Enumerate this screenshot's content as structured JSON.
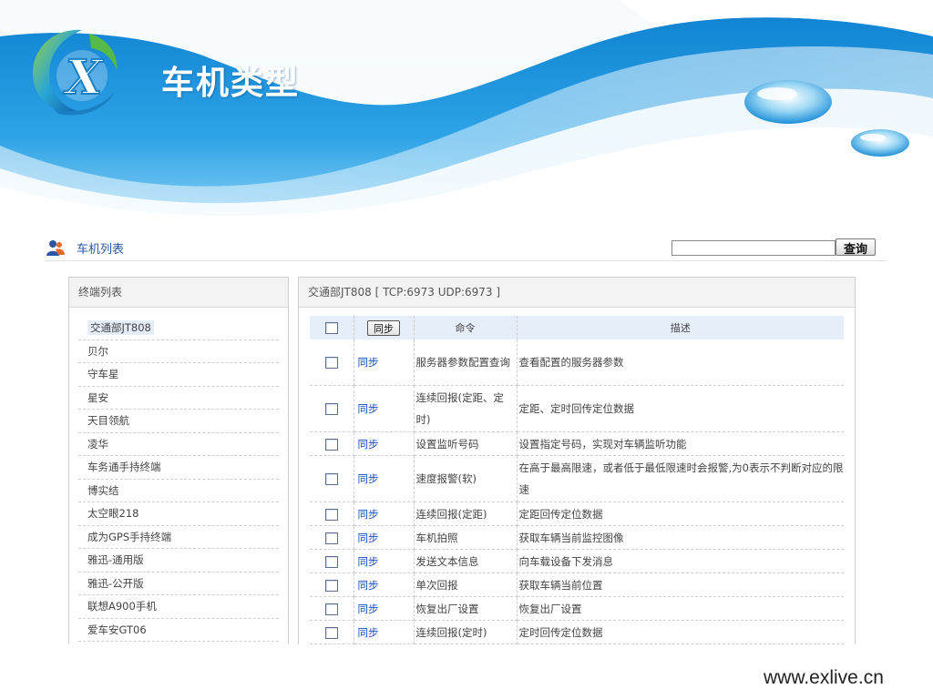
{
  "slide": {
    "title": "车机类型",
    "footer_url": "www.exlive.cn"
  },
  "colors": {
    "accent": "#1e8fd8",
    "link": "#1a4fbf",
    "header_bg": "#e6eef9"
  },
  "toolbar": {
    "heading": "车机列表",
    "heading_icon": "users-icon",
    "search_value": "",
    "search_button": "查询"
  },
  "left_panel": {
    "title": "终端列表",
    "items": [
      "交通部JT808",
      "贝尔",
      "守车星",
      "星安",
      "天目领航",
      "凌华",
      "车务通手持终端",
      "博实结",
      "太空眼218",
      "成为GPS手持终端",
      "雅迅-通用版",
      "雅迅-公开版",
      "联想A900手机",
      "爱车安GT06"
    ],
    "selected_index": 0
  },
  "right_panel": {
    "title": "交通部JT808 [ TCP:6973 UDP:6973 ]",
    "columns": {
      "sync_button": "同步",
      "command": "命令",
      "description": "描述"
    },
    "rows": [
      {
        "link": "同步",
        "command": "服务器参数配置查询",
        "description": "查看配置的服务器参数"
      },
      {
        "link": "同步",
        "command": "连续回报(定距、定时)",
        "description": "定距、定时回传定位数据"
      },
      {
        "link": "同步",
        "command": "设置监听号码",
        "description": "设置指定号码，实现对车辆监听功能"
      },
      {
        "link": "同步",
        "command": "速度报警(软)",
        "description": "在高于最高限速，或者低于最低限速时会报警,为0表示不判断对应的限速"
      },
      {
        "link": "同步",
        "command": "连续回报(定距)",
        "description": "定距回传定位数据"
      },
      {
        "link": "同步",
        "command": "车机拍照",
        "description": "获取车辆当前监控图像"
      },
      {
        "link": "同步",
        "command": "发送文本信息",
        "description": "向车载设备下发消息"
      },
      {
        "link": "同步",
        "command": "单次回报",
        "description": "获取车辆当前位置"
      },
      {
        "link": "同步",
        "command": "恢复出厂设置",
        "description": "恢复出厂设置"
      },
      {
        "link": "同步",
        "command": "连续回报(定时)",
        "description": "定时回传定位数据"
      }
    ]
  }
}
